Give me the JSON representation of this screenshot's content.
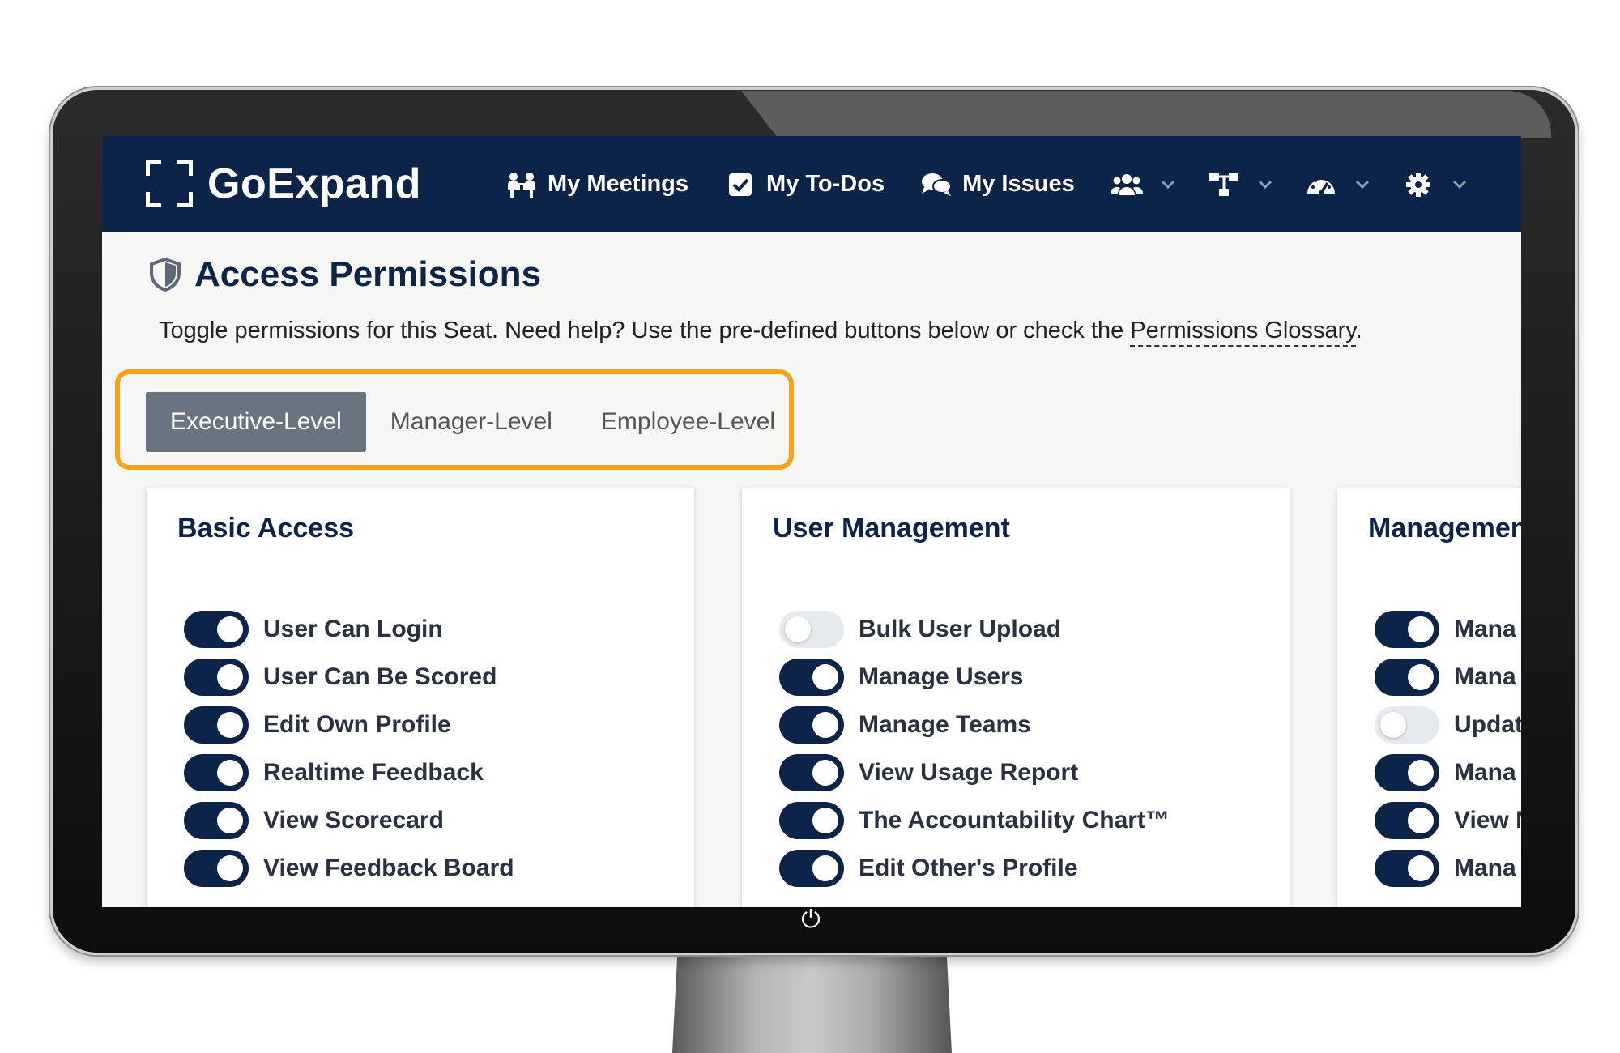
{
  "brand": {
    "name": "GoExpand"
  },
  "nav": {
    "items": [
      {
        "label": "My Meetings",
        "icon": "meetings-icon"
      },
      {
        "label": "My To-Dos",
        "icon": "checkbox-icon"
      },
      {
        "label": "My Issues",
        "icon": "chat-icon"
      }
    ],
    "dropdowns": [
      {
        "icon": "users-icon"
      },
      {
        "icon": "org-chart-icon"
      },
      {
        "icon": "dashboard-icon"
      },
      {
        "icon": "gear-icon"
      }
    ]
  },
  "page": {
    "title": "Access Permissions",
    "help_text": "Toggle permissions for this Seat. Need help? Use the pre-defined buttons below or check the ",
    "help_link": "Permissions Glossary",
    "help_end": "."
  },
  "levels": {
    "tabs": [
      "Executive-Level",
      "Manager-Level",
      "Employee-Level"
    ],
    "active": "Executive-Level"
  },
  "cards": [
    {
      "title": "Basic Access",
      "permissions": [
        {
          "label": "User Can Login",
          "enabled": true
        },
        {
          "label": "User Can Be Scored",
          "enabled": true
        },
        {
          "label": "Edit Own Profile",
          "enabled": true
        },
        {
          "label": "Realtime Feedback",
          "enabled": true
        },
        {
          "label": "View Scorecard",
          "enabled": true
        },
        {
          "label": "View Feedback Board",
          "enabled": true
        }
      ]
    },
    {
      "title": "User Management",
      "permissions": [
        {
          "label": "Bulk User Upload",
          "enabled": false
        },
        {
          "label": "Manage Users",
          "enabled": true
        },
        {
          "label": "Manage Teams",
          "enabled": true
        },
        {
          "label": "View Usage Report",
          "enabled": true
        },
        {
          "label": "The Accountability Chart™",
          "enabled": true
        },
        {
          "label": "Edit Other's Profile",
          "enabled": true
        }
      ]
    },
    {
      "title": "Managemen",
      "permissions": [
        {
          "label": "Mana",
          "enabled": true
        },
        {
          "label": "Mana",
          "enabled": true
        },
        {
          "label": "Updat",
          "enabled": false
        },
        {
          "label": "Mana",
          "enabled": true
        },
        {
          "label": "View M",
          "enabled": true
        },
        {
          "label": "Mana",
          "enabled": true
        }
      ]
    }
  ],
  "colors": {
    "navbar": "#0b2447",
    "highlight": "#f8a21b",
    "active_tab": "#697481",
    "toggle_on": "#0b2447",
    "toggle_off": "#e6e9ee"
  }
}
